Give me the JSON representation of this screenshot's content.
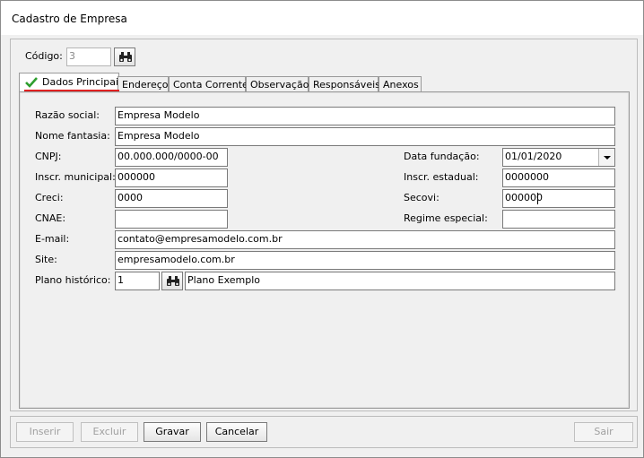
{
  "window": {
    "title": "Cadastro de Empresa"
  },
  "header": {
    "codigo_label": "Código:",
    "codigo_value": "3"
  },
  "tabs": [
    {
      "label": "Dados Principais"
    },
    {
      "label": "Endereço"
    },
    {
      "label": "Conta Corrente"
    },
    {
      "label": "Observação"
    },
    {
      "label": "Responsáveis"
    },
    {
      "label": "Anexos"
    }
  ],
  "form": {
    "razao_social": {
      "label": "Razão social:",
      "value": "Empresa Modelo"
    },
    "nome_fantasia": {
      "label": "Nome fantasia:",
      "value": "Empresa Modelo"
    },
    "cnpj": {
      "label": "CNPJ:",
      "value": "00.000.000/0000-00"
    },
    "data_fundacao": {
      "label": "Data fundação:",
      "value": "01/01/2020"
    },
    "inscr_municipal": {
      "label": "Inscr. municipal:",
      "value": "000000"
    },
    "inscr_estadual": {
      "label": "Inscr. estadual:",
      "value": "0000000"
    },
    "creci": {
      "label": "Creci:",
      "value": "0000"
    },
    "secovi": {
      "label": "Secovi:",
      "value": "000000"
    },
    "cnae": {
      "label": "CNAE:",
      "value": ""
    },
    "regime_especial": {
      "label": "Regime especial:",
      "value": ""
    },
    "email": {
      "label": "E-mail:",
      "value": "contato@empresamodelo.com.br"
    },
    "site": {
      "label": "Site:",
      "value": "empresamodelo.com.br"
    },
    "plano_historico": {
      "label": "Plano histórico:",
      "code": "1",
      "name": "Plano Exemplo"
    }
  },
  "footer": {
    "inserir": "Inserir",
    "excluir": "Excluir",
    "gravar": "Gravar",
    "cancelar": "Cancelar",
    "sair": "Sair"
  },
  "colors": {
    "check": "#2e9e2e",
    "active_tab_underline": "#e02020"
  },
  "icons": {
    "search": "binoculars-icon",
    "check": "checkmark-icon",
    "dropdown": "chevron-down-icon"
  }
}
